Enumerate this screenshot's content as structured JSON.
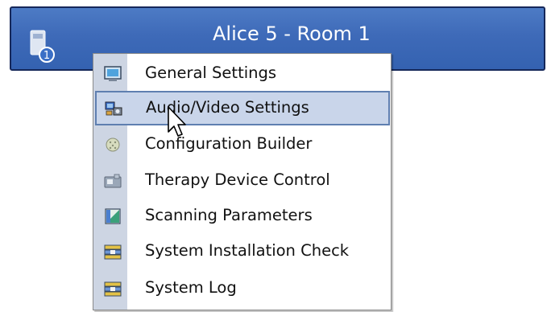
{
  "window": {
    "title": "Alice 5 - Room 1",
    "badge_number": "1"
  },
  "menu": {
    "items": [
      {
        "label": "General Settings",
        "icon": "monitor-icon"
      },
      {
        "label": "Audio/Video Settings",
        "icon": "audio-video-icon",
        "highlighted": true
      },
      {
        "label": "Configuration Builder",
        "icon": "configuration-builder-icon"
      },
      {
        "label": "Therapy Device Control",
        "icon": "therapy-device-icon"
      },
      {
        "label": "Scanning Parameters",
        "icon": "scanning-parameters-icon"
      },
      {
        "label": "System Installation Check",
        "icon": "system-icon"
      },
      {
        "label": "System Log",
        "icon": "system-icon"
      }
    ]
  },
  "colors": {
    "titlebar": "#3e6ab8",
    "menu_highlight": "#c9d5ea",
    "menu_strip": "#cdd5e3"
  }
}
